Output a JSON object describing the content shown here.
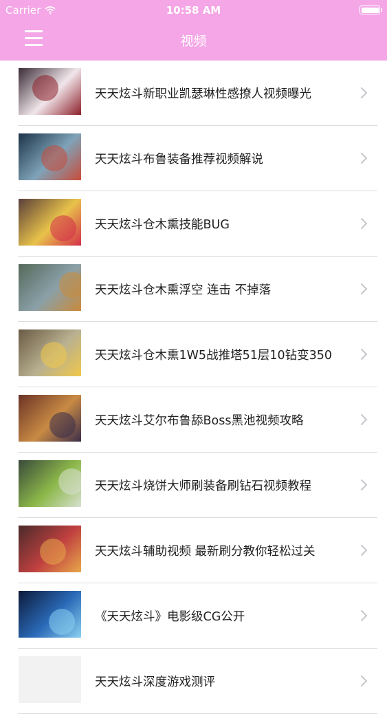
{
  "status_bar": {
    "carrier": "Carrier",
    "time": "10:58 AM"
  },
  "nav": {
    "title": "视频",
    "menu_icon": "hamburger-icon"
  },
  "videos": [
    {
      "title": "天天炫斗新职业凯瑟琳性感撩人视频曝光",
      "thumb_colors": [
        "#3b2b36",
        "#f0e6ea",
        "#8c1f2a"
      ]
    },
    {
      "title": "天天炫斗布鲁装备推荐视频解说",
      "thumb_colors": [
        "#1d3348",
        "#7ea3b8",
        "#c94b3a"
      ]
    },
    {
      "title": "天天炫斗仓木熏技能BUG",
      "thumb_colors": [
        "#5a3f3a",
        "#e8c24a",
        "#d42f4a"
      ]
    },
    {
      "title": "天天炫斗仓木熏浮空 连击 不掉落",
      "thumb_colors": [
        "#55695a",
        "#8aa0a8",
        "#c98a3a"
      ]
    },
    {
      "title": "天天炫斗仓木熏1W5战推塔51层10钻变350",
      "thumb_colors": [
        "#6a5a44",
        "#b8b090",
        "#f0c84a"
      ]
    },
    {
      "title": "天天炫斗艾尔布鲁舔Boss黑池视频攻略",
      "thumb_colors": [
        "#6a3326",
        "#c98a44",
        "#3a2d4a"
      ]
    },
    {
      "title": "天天炫斗烧饼大师刷装备刷钻石视频教程",
      "thumb_colors": [
        "#3a4a3a",
        "#8cb84a",
        "#d8e0d0"
      ]
    },
    {
      "title": "天天炫斗辅助视频 最新刷分教你轻松过关",
      "thumb_colors": [
        "#4a2a2a",
        "#c04040",
        "#e8a84a"
      ]
    },
    {
      "title": "《天天炫斗》电影级CG公开",
      "thumb_colors": [
        "#0d1a3a",
        "#2a6ab8",
        "#8ad0f0"
      ]
    },
    {
      "title": "天天炫斗深度游戏测评",
      "thumb_colors": [
        "#f2f2f2",
        "#e6e6e6",
        "#dddddd"
      ]
    }
  ],
  "colors": {
    "header_pink": "#f4a6e6",
    "divider": "#dcdcdc",
    "chevron": "#c7c7cc",
    "text": "#222222"
  }
}
